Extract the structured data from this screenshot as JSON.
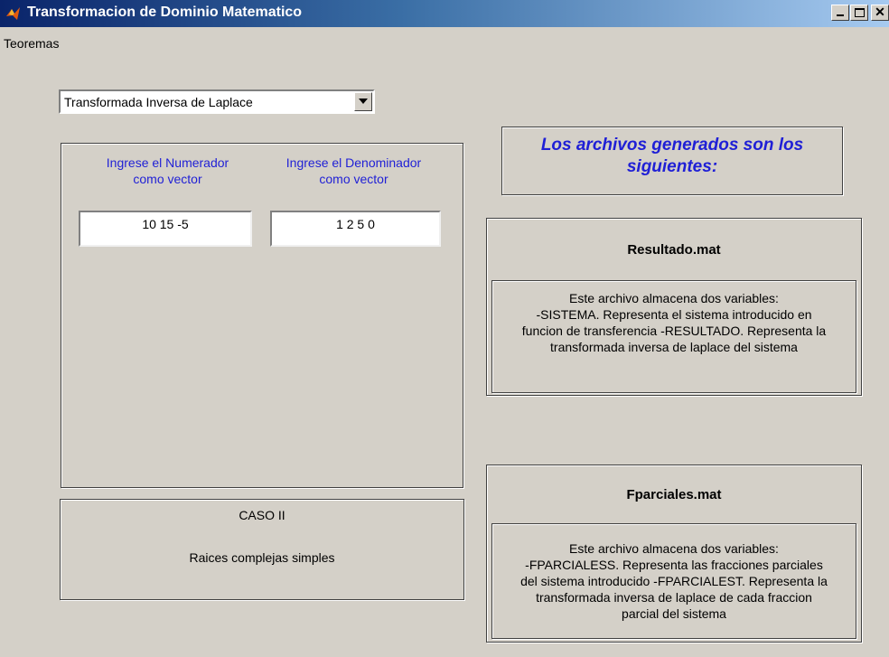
{
  "window": {
    "title": "Transformacion de Dominio Matematico",
    "minimize_icon": "minimize-icon",
    "maximize_icon": "maximize-icon",
    "close_icon": "close-icon"
  },
  "menu": {
    "items": [
      "Teoremas"
    ]
  },
  "selector": {
    "selected": "Transformada Inversa de Laplace"
  },
  "inputs": {
    "numerator_label_line1": "Ingrese el Numerador",
    "numerator_label_line2": "como vector",
    "numerator_value": "10 15 -5",
    "denominator_label_line1": "Ingrese el Denominador",
    "denominator_label_line2": "como vector",
    "denominator_value": "1 2 5 0"
  },
  "case": {
    "title": "CASO II",
    "description": "Raices complejas simples"
  },
  "files": {
    "header_line1": "Los archivos generados son los",
    "header_line2": "siguientes:",
    "resultado": {
      "name": "Resultado.mat",
      "line1": "Este archivo almacena dos variables:",
      "line2": "-SISTEMA. Representa el sistema introducido en",
      "line3": "funcion de transferencia -RESULTADO. Representa la",
      "line4": "transformada inversa de laplace del sistema"
    },
    "fparciales": {
      "name": "Fparciales.mat",
      "line1": "Este archivo almacena dos variables:",
      "line2": "-FPARCIALESS. Representa las fracciones parciales",
      "line3": "del sistema introducido -FPARCIALEST. Representa la",
      "line4": "transformada inversa de laplace de cada fraccion",
      "line5": "parcial del sistema"
    }
  },
  "colors": {
    "face": "#d4d0c8",
    "title_start": "#0a246a",
    "label_blue": "#1f1fd6"
  }
}
